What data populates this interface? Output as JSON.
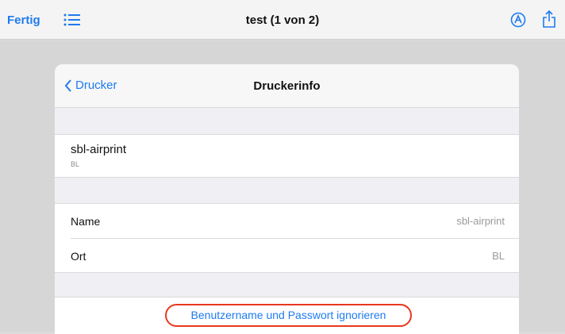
{
  "toolbar": {
    "done_label": "Fertig",
    "list_icon": "list-icon",
    "title": "test (1 von 2)",
    "markup_icon": "markup-icon",
    "share_icon": "share-icon"
  },
  "sheet": {
    "back_label": "Drucker",
    "title": "Druckerinfo",
    "printer": {
      "name": "sbl-airprint",
      "location_short": "BL"
    },
    "info_rows": [
      {
        "label": "Name",
        "value": "sbl-airprint"
      },
      {
        "label": "Ort",
        "value": "BL"
      }
    ],
    "action_label": "Benutzername und Passwort ignorieren"
  },
  "colors": {
    "accent": "#1e7bf0",
    "highlight_outline": "#e8381e"
  }
}
